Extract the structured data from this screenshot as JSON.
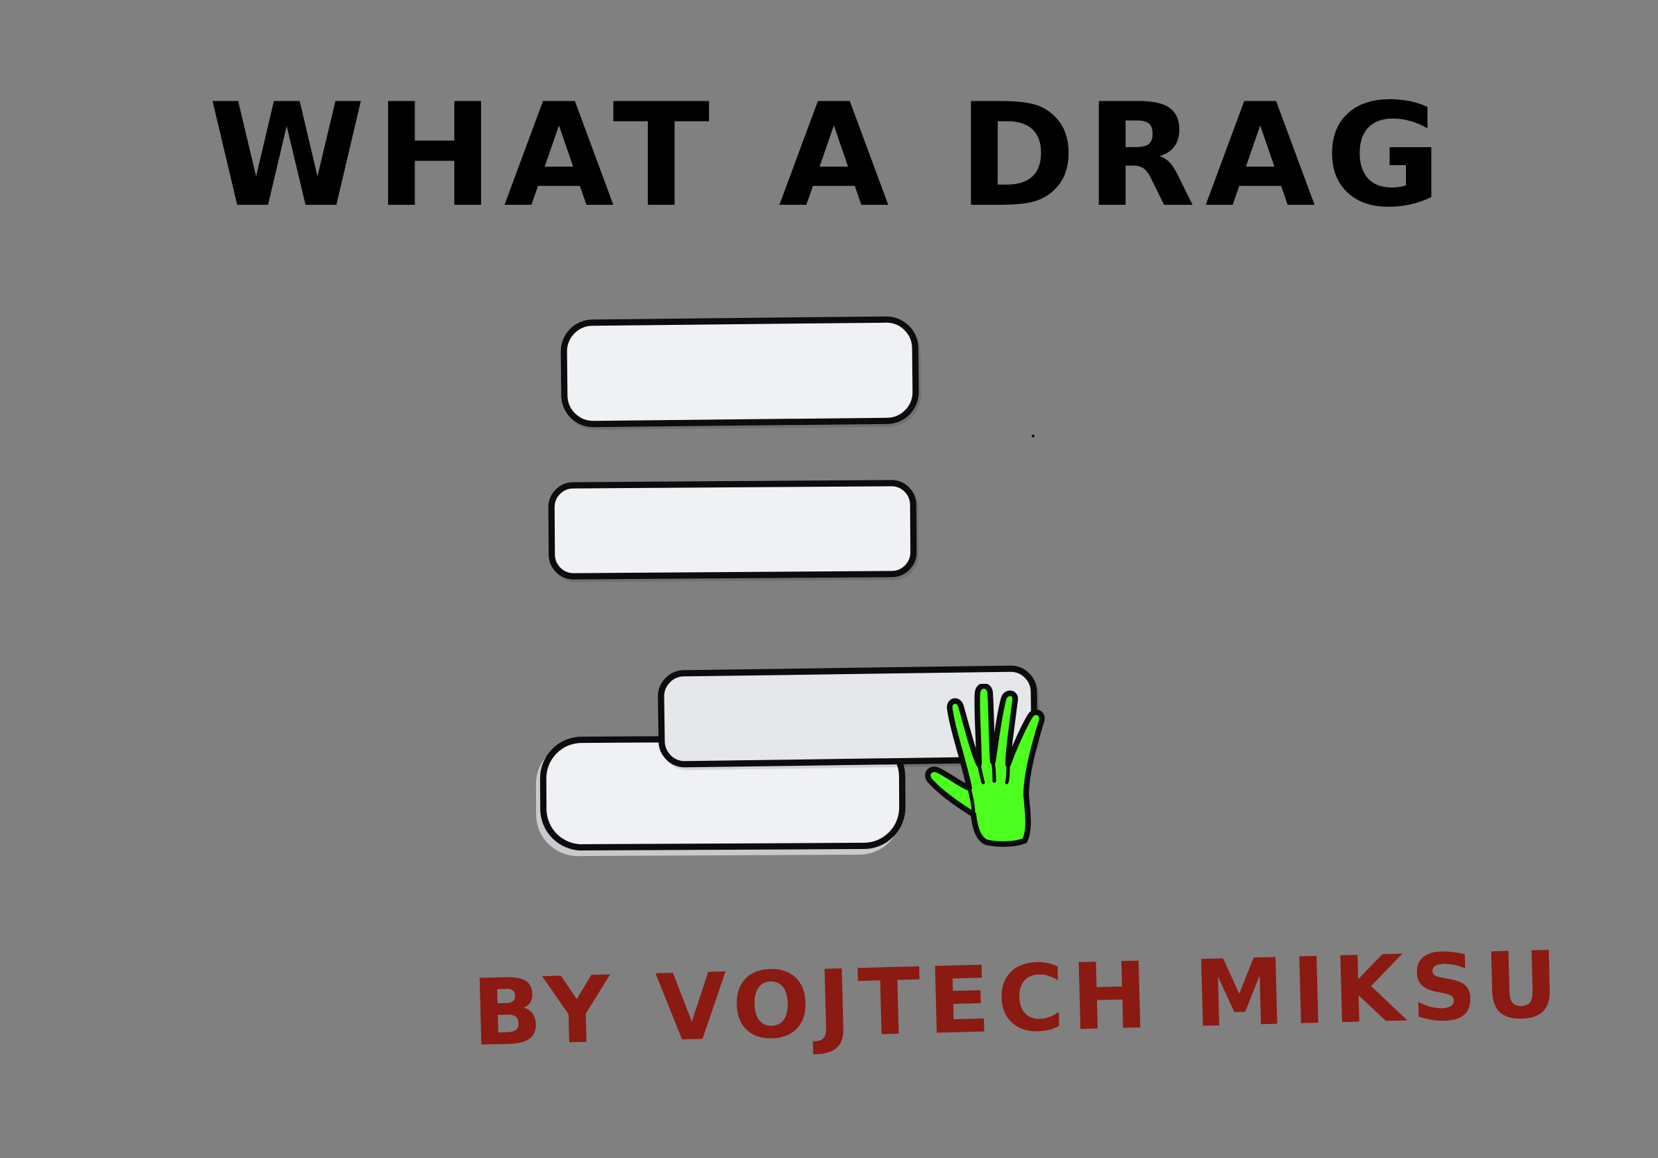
{
  "title": "WHAT A DRAG",
  "byline": "BY VOJTECH MIKSU",
  "colors": {
    "background": "#808080",
    "title": "#000000",
    "byline": "#8b1a12",
    "bar_fill": "#f0f1f5",
    "bar_outline": "#0c0c0c",
    "hand": "#4cff1e"
  },
  "icons": {
    "cursor": "grab-hand-icon"
  }
}
